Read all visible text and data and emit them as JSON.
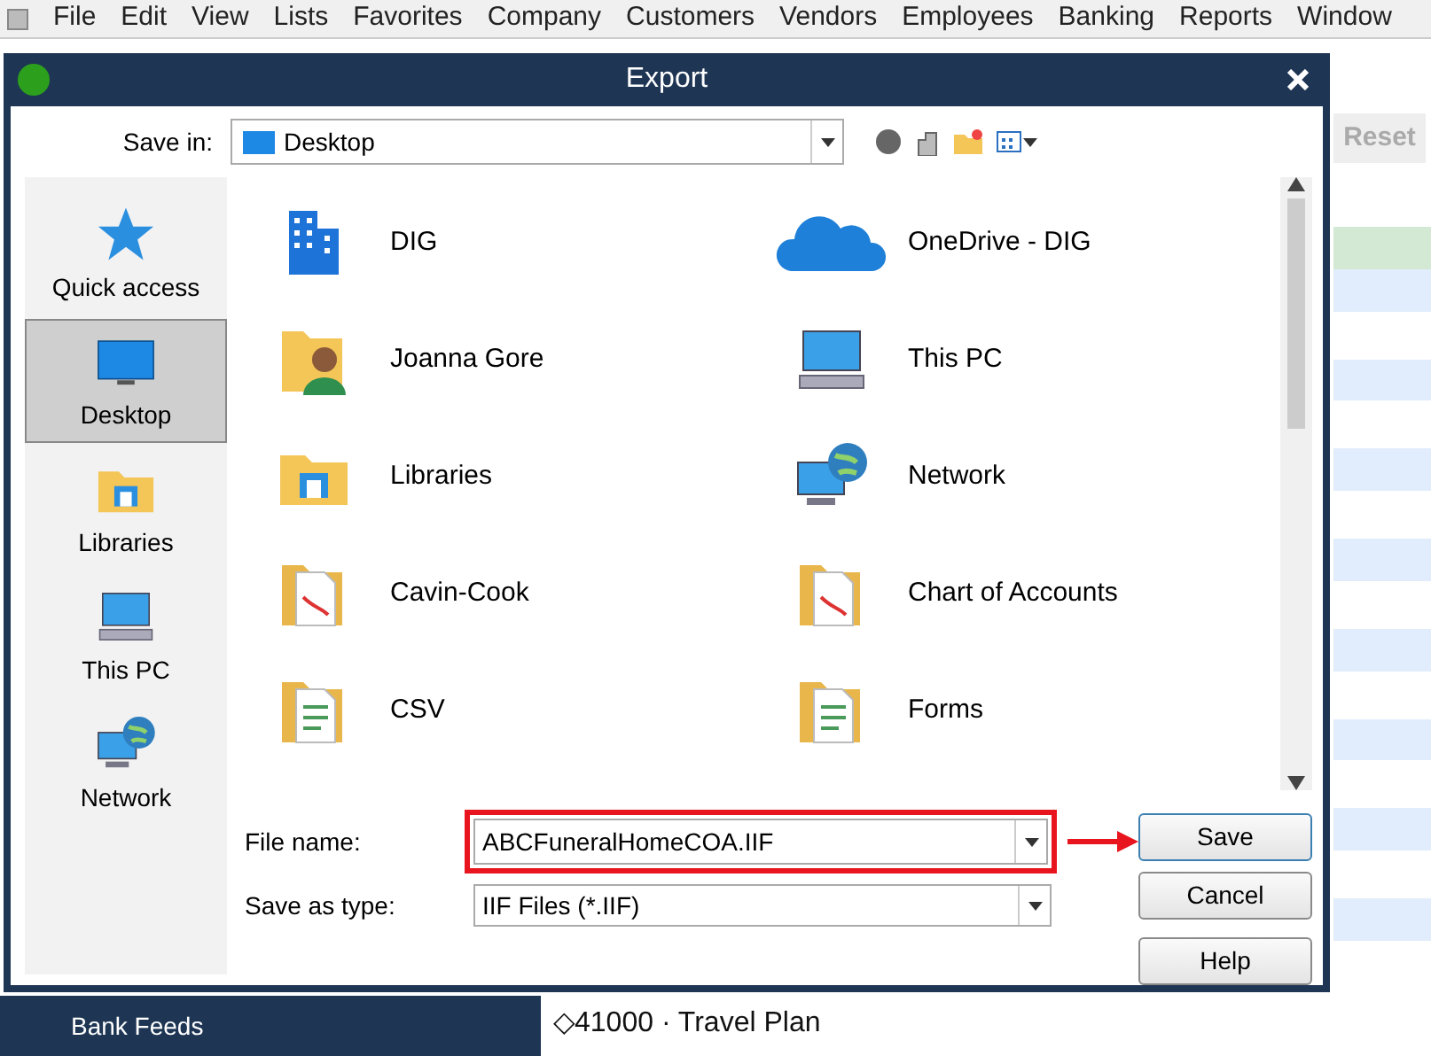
{
  "menu": [
    "File",
    "Edit",
    "View",
    "Lists",
    "Favorites",
    "Company",
    "Customers",
    "Vendors",
    "Employees",
    "Banking",
    "Reports",
    "Window"
  ],
  "background": {
    "reset_button": "Reset",
    "sidebar_item": "Bank Feeds",
    "account_row": "◇41000 · Travel Plan"
  },
  "dialog": {
    "title": "Export",
    "save_in": {
      "label": "Save in:",
      "value": "Desktop"
    },
    "places": [
      {
        "label": "Quick access",
        "kind": "star",
        "selected": false
      },
      {
        "label": "Desktop",
        "kind": "monitor",
        "selected": true
      },
      {
        "label": "Libraries",
        "kind": "folder",
        "selected": false
      },
      {
        "label": "This PC",
        "kind": "computer",
        "selected": false
      },
      {
        "label": "Network",
        "kind": "network",
        "selected": false
      }
    ],
    "files": [
      {
        "name": "DIG",
        "kind": "building"
      },
      {
        "name": "OneDrive - DIG",
        "kind": "cloud"
      },
      {
        "name": "Joanna Gore",
        "kind": "user"
      },
      {
        "name": "This PC",
        "kind": "computer"
      },
      {
        "name": "Libraries",
        "kind": "folder"
      },
      {
        "name": "Network",
        "kind": "network"
      },
      {
        "name": "Cavin-Cook",
        "kind": "pdf"
      },
      {
        "name": "Chart of Accounts",
        "kind": "pdf"
      },
      {
        "name": "CSV",
        "kind": "document"
      },
      {
        "name": "Forms",
        "kind": "document"
      }
    ],
    "file_name": {
      "label": "File name:",
      "value": "ABCFuneralHomeCOA.IIF",
      "highlighted": true
    },
    "save_as_type": {
      "label": "Save as type:",
      "value": "IIF Files (*.IIF)"
    },
    "buttons": [
      "Save",
      "Cancel",
      "Help"
    ]
  }
}
